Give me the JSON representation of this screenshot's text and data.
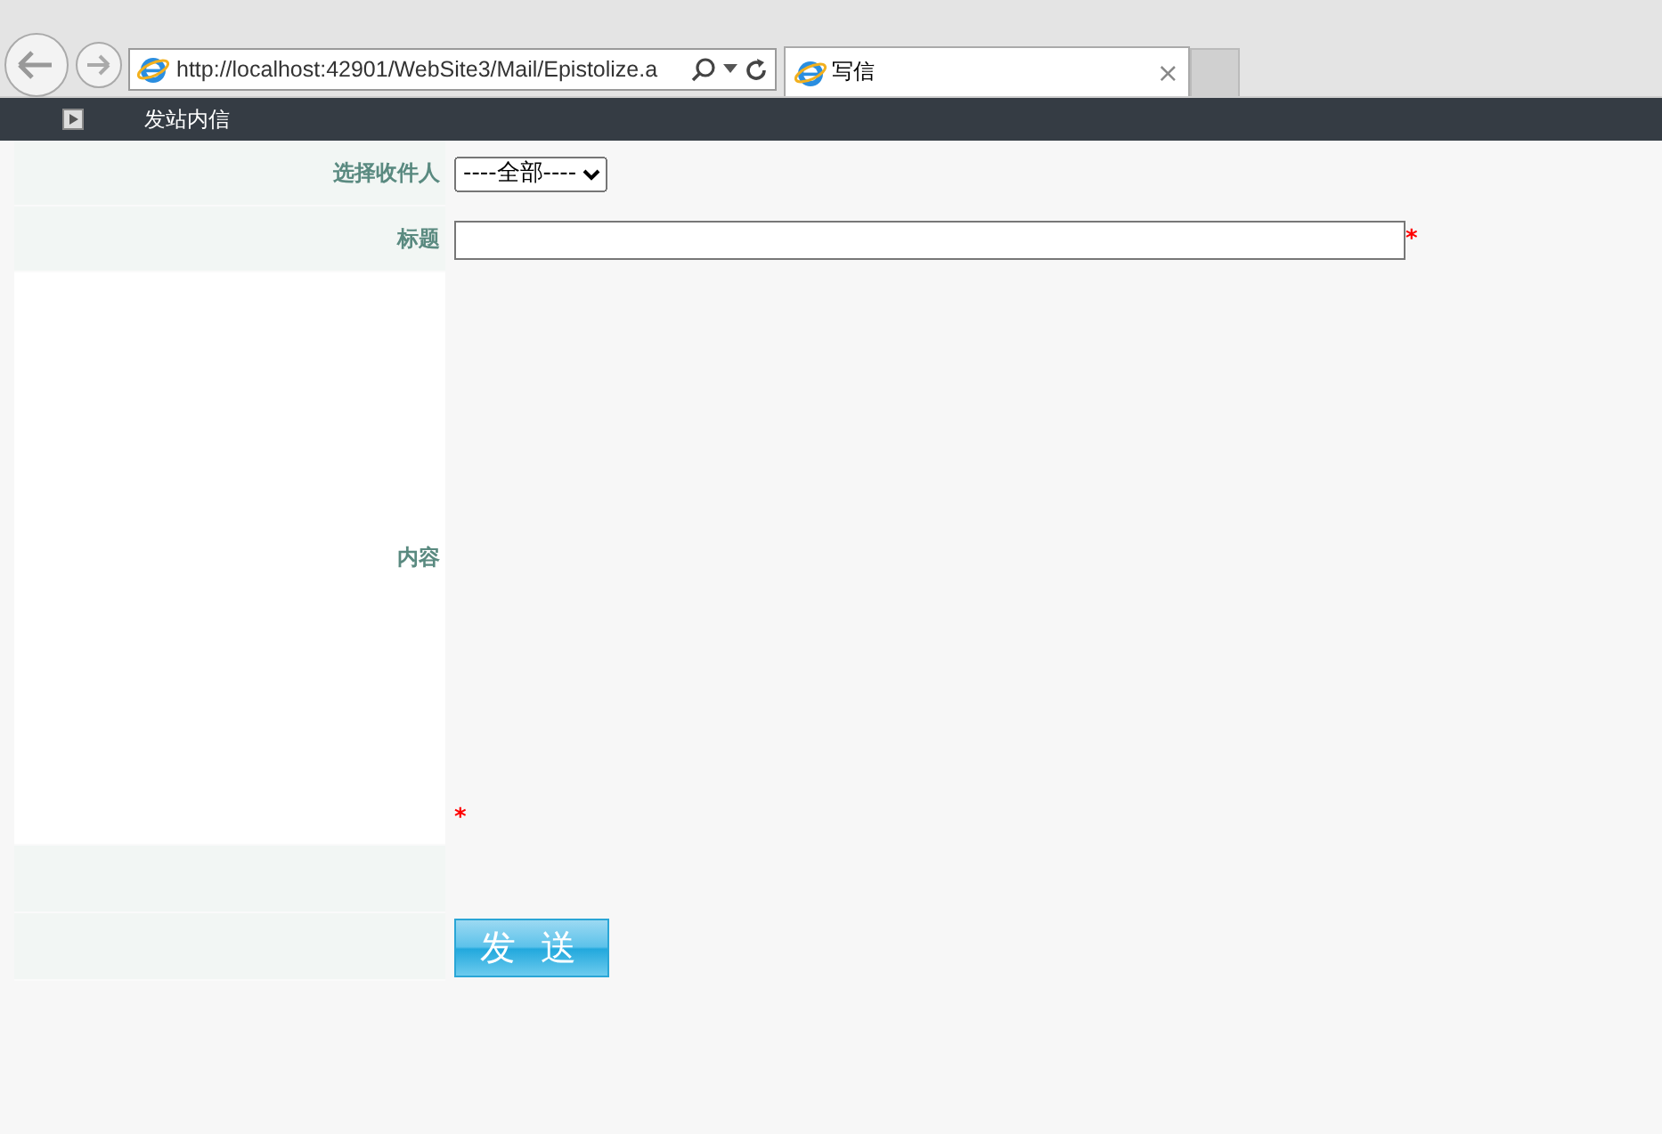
{
  "browser": {
    "address": "http://localhost:42901/WebSite3/Mail/Epistolize.a",
    "tab_title": "写信",
    "tab_close": "×"
  },
  "nav": {
    "title": "发站内信"
  },
  "form": {
    "recipient_label": "选择收件人",
    "recipient_value": "----全部----",
    "subject_label": "标题",
    "subject_required": "*",
    "content_label": "内容",
    "content_required": "*",
    "send_button": "发 送"
  }
}
